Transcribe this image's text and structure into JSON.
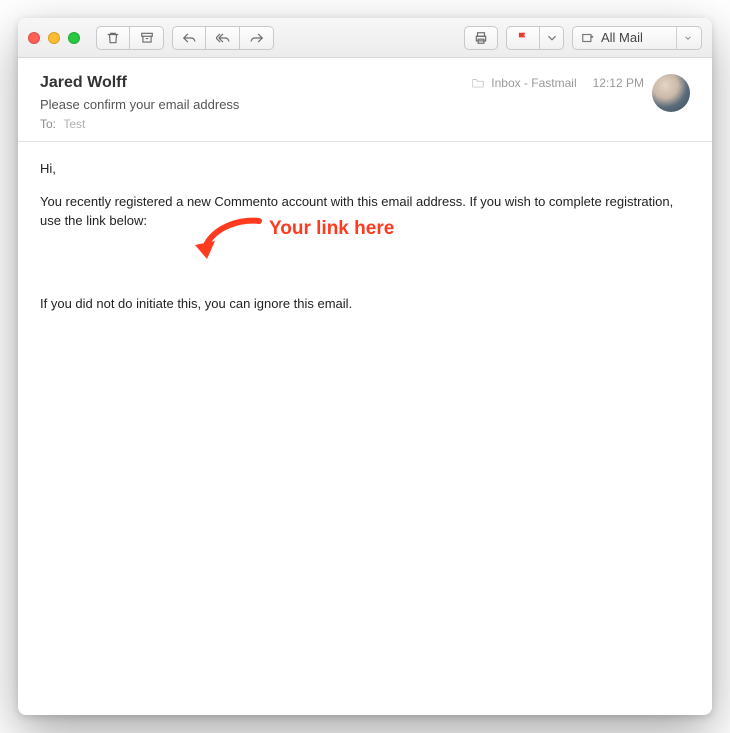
{
  "toolbar": {
    "mailbox": "All Mail"
  },
  "header": {
    "sender": "Jared Wolff",
    "subject": "Please confirm your email address",
    "to_label": "To:",
    "to_value": "Test",
    "folder": "Inbox - Fastmail",
    "time": "12:12 PM"
  },
  "body": {
    "greeting": "Hi,",
    "p1": "You recently registered a new Commento account with this email address. If you wish to complete registration, use the link below:",
    "p2": "If you did not do initiate this, you can ignore this email."
  },
  "annotation": {
    "label": "Your link here"
  }
}
